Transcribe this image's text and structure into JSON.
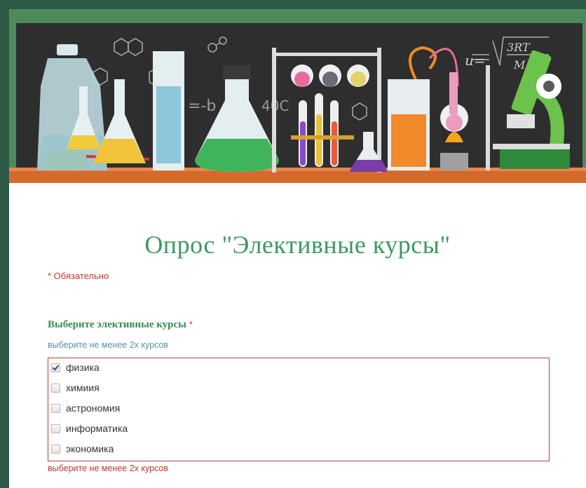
{
  "form": {
    "title": "Опрос \"Элективные курсы\"",
    "required_note": "* Обязательно",
    "header_image": "science-lab-chalkboard-banner"
  },
  "question": {
    "title": "Выберите элективные курсы",
    "required_marker": "*",
    "help_text": "выберите не менее 2х курсов",
    "error_text": "выберите не менее 2х курсов",
    "options": [
      {
        "label": "физика",
        "checked": true
      },
      {
        "label": "химиия",
        "checked": false
      },
      {
        "label": "астрономия",
        "checked": false
      },
      {
        "label": "информатика",
        "checked": false
      },
      {
        "label": "экономика",
        "checked": false
      }
    ]
  },
  "colors": {
    "page_border": "#2f5a48",
    "title": "#3a9a5e",
    "required": "#c0392b",
    "help": "#5b8fa6",
    "error_border": "#a94438"
  }
}
